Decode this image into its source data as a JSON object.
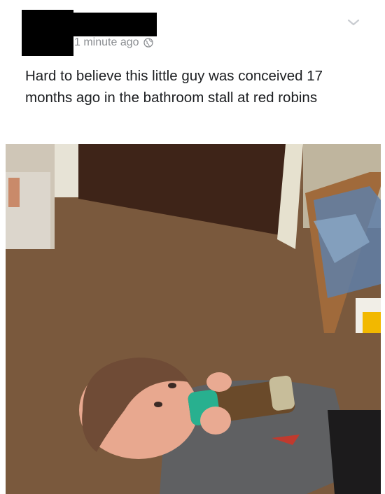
{
  "post": {
    "timestamp": "1 minute ago",
    "text": "Hard to believe this little guy was conceived 17 months ago in the bathroom stall at red robins",
    "icons": [
      "globe-icon",
      "chevron-down-icon"
    ]
  },
  "colors": {
    "text": "#1c1e21",
    "meta": "#8a8d91",
    "redaction": "#000000"
  }
}
